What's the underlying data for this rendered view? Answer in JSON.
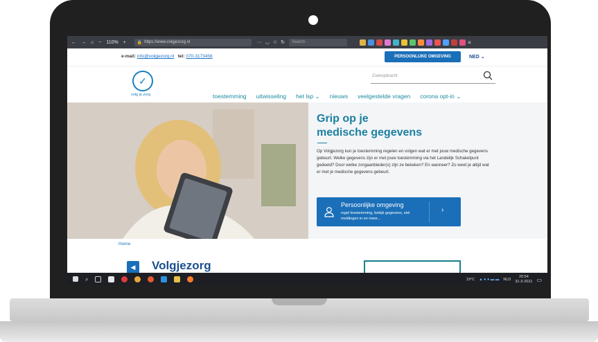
{
  "browser": {
    "zoom": "110%",
    "url": "https://www.volgjezorg.nl",
    "search_placeholder": "Search"
  },
  "topbar": {
    "email_label": "e-mail:",
    "email": "info@volgjezorg.nl",
    "phone_label": "tel:",
    "phone": "070-3173456",
    "env_button": "PERSOONLIJKE OMGEVING",
    "language": "NED ⌄"
  },
  "header": {
    "logo_text": "volg je zorg",
    "search_placeholder": "Zoekopdracht",
    "menu": [
      "toestemming",
      "uitwisseling",
      "het lsp ⌄",
      "nieuws",
      "veelgestelde vragen",
      "corona opt-in ⌄"
    ]
  },
  "hero": {
    "title_line1": "Grip op je",
    "title_line2": "medische gegevens",
    "text": "Op Volgjezorg kun je toestemming regelen en volgen wat er met jouw medische gegevens gebeurt. Welke gegevens zijn er met jouw toestemming via het Landelijk Schakelpunt gedeeld? Door welke zorgaanbieder(s) zijn ze bekeken? En wanneer? Zo weet je altijd wat er met je medische gegevens gebeurt.",
    "cta_title": "Persoonlijke omgeving",
    "cta_sub": "regel toestemming, bekijk gegevens, stel meldingen in en meer..."
  },
  "breadcrumb": "Home",
  "page_title": "Volgjezorg",
  "taskbar": {
    "weather": "19°C",
    "language": "NLD",
    "time": "20:54",
    "date": "31-3-2021"
  }
}
